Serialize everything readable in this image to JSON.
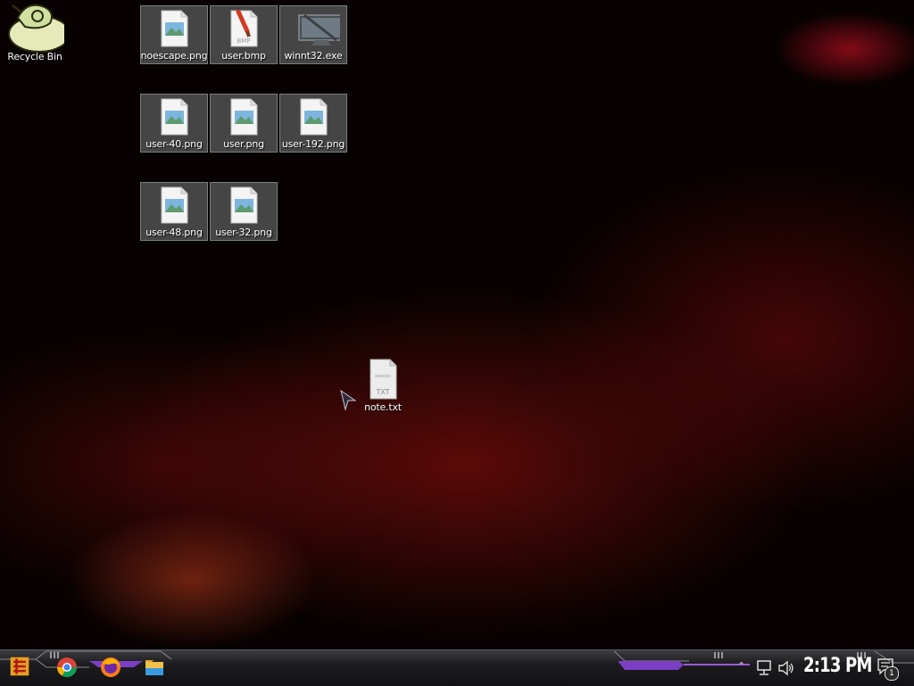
{
  "desktop": {
    "recycle_bin": {
      "label": "Recycle Bin",
      "icon": "recycle-bin-icon"
    },
    "files": [
      {
        "label": "noescape.png",
        "icon": "png-image-icon"
      },
      {
        "label": "user.bmp",
        "icon": "bmp-image-icon"
      },
      {
        "label": "winnt32.exe",
        "icon": "monitor-exe-icon"
      },
      {
        "label": "user-40.png",
        "icon": "png-image-icon"
      },
      {
        "label": "user.png",
        "icon": "png-image-icon"
      },
      {
        "label": "user-192.png",
        "icon": "png-image-icon"
      },
      {
        "label": "user-48.png",
        "icon": "png-image-icon"
      },
      {
        "label": "user-32.png",
        "icon": "png-image-icon"
      }
    ],
    "note": {
      "label": "note.txt",
      "badge": "TXT",
      "icon": "text-file-icon"
    },
    "bmp_badge": "BMP"
  },
  "taskbar": {
    "start": "start-button-icon",
    "pinned": [
      "chrome-icon",
      "firefox-icon",
      "file-explorer-icon"
    ],
    "tray": [
      "show-hidden-icons",
      "network-icon",
      "volume-icon"
    ],
    "clock": "2:13 PM",
    "notifications": {
      "icon": "notification-icon",
      "count": "1"
    }
  },
  "colors": {
    "accent_purple": "#7b3fc4",
    "background": "#070101",
    "selection": "#5f5f5f"
  }
}
